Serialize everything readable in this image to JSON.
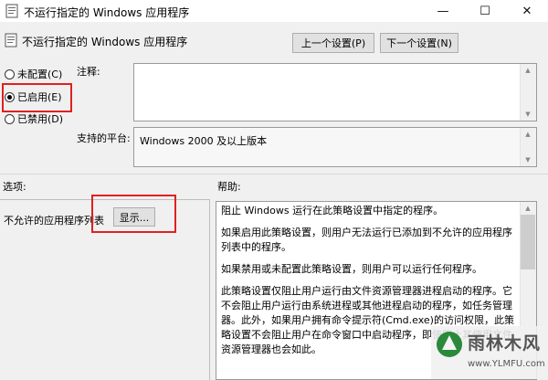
{
  "window": {
    "title": "不运行指定的 Windows 应用程序",
    "minimize_glyph": "—",
    "maximize_glyph": "☐",
    "close_glyph": "✕"
  },
  "header": {
    "title": "不运行指定的 Windows 应用程序",
    "prev_button": "上一个设置(P)",
    "next_button": "下一个设置(N)"
  },
  "state": {
    "options": [
      {
        "label": "未配置(C)",
        "checked": false
      },
      {
        "label": "已启用(E)",
        "checked": true
      },
      {
        "label": "已禁用(D)",
        "checked": false
      }
    ]
  },
  "comment": {
    "label": "注释:",
    "value": ""
  },
  "platform": {
    "label": "支持的平台:",
    "value": "Windows 2000 及以上版本"
  },
  "options_panel": {
    "heading": "选项:",
    "item_label": "不允许的应用程序列表",
    "show_button": "显示..."
  },
  "help_panel": {
    "heading": "帮助:",
    "paragraphs": [
      "阻止 Windows 运行在此策略设置中指定的程序。",
      "如果启用此策略设置，则用户无法运行已添加到不允许的应用程序列表中的程序。",
      "如果禁用或未配置此策略设置，则用户可以运行任何程序。",
      "此策略设置仅阻止用户运行由文件资源管理器进程启动的程序。它不会阻止用户运行由系统进程或其他进程启动的程序，如任务管理器。此外，如果用户拥有命令提示符(Cmd.exe)的访问权限，此策略设置不会阻止用户在命令窗口中启动程序，即使阻止其使用文件资源管理器也会如此。"
    ]
  },
  "watermark": {
    "text": "雨林木风",
    "url": "www.YLMFU.com"
  }
}
